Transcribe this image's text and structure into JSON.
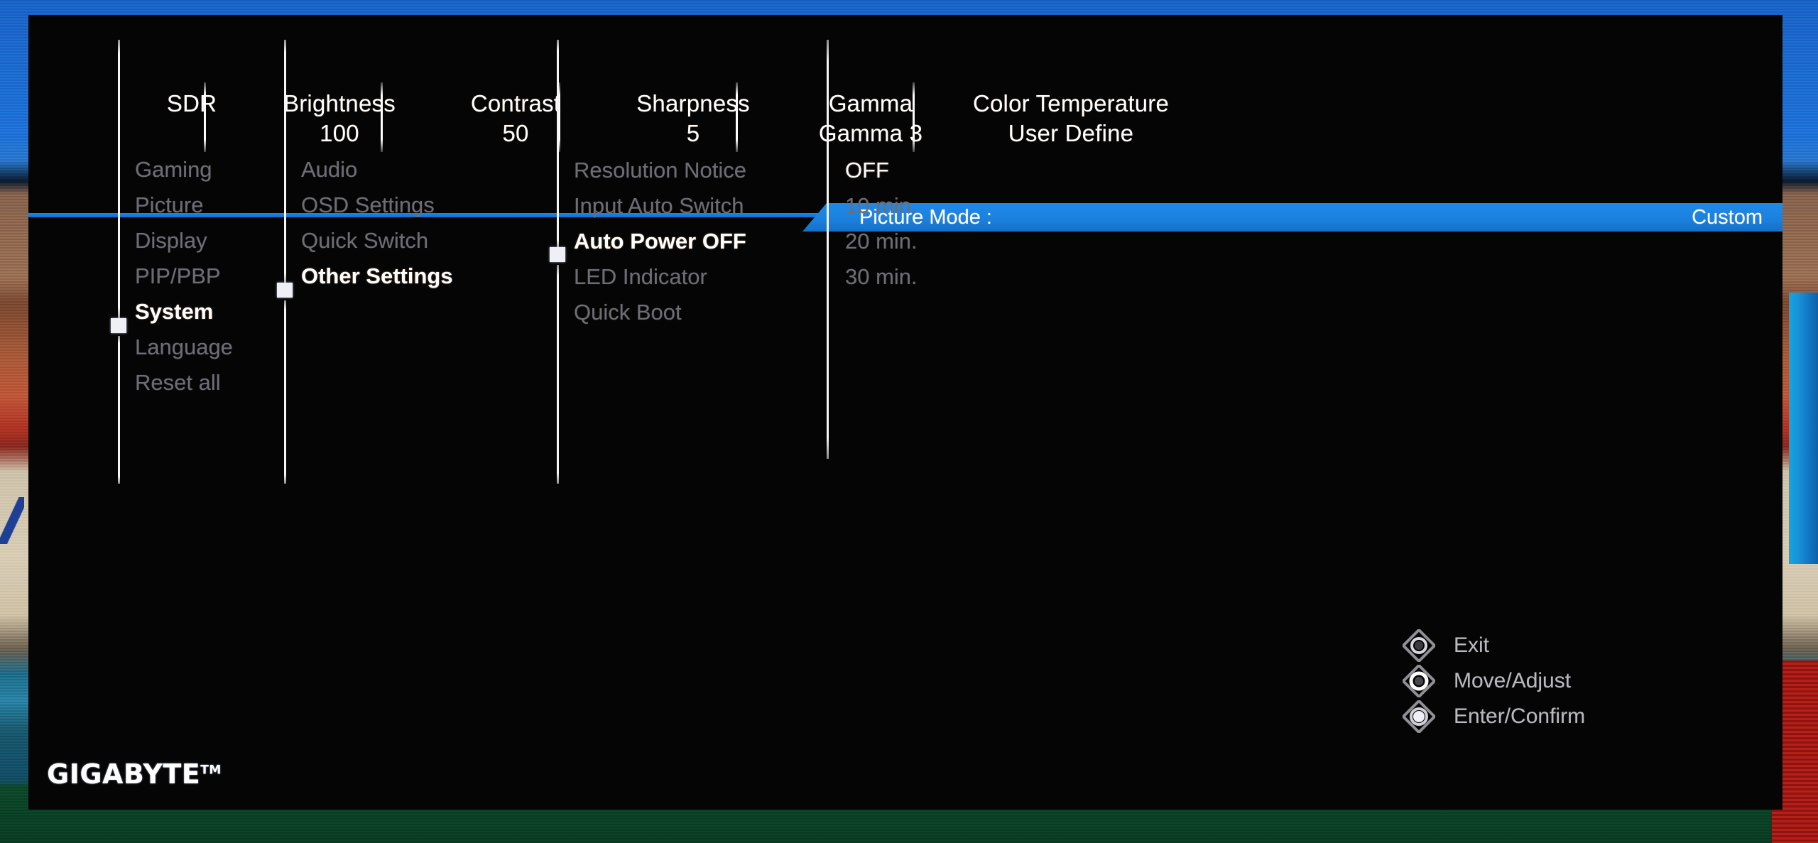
{
  "panel": {
    "brand": "GIGABYTE",
    "brand_tm": "TM"
  },
  "header": {
    "items": [
      {
        "label": "SDR",
        "value": ""
      },
      {
        "label": "Brightness",
        "value": "100"
      },
      {
        "label": "Contrast",
        "value": "50"
      },
      {
        "label": "Sharpness",
        "value": "5"
      },
      {
        "label": "Gamma",
        "value": "Gamma 3"
      },
      {
        "label": "Color Temperature",
        "value": "User Define"
      }
    ]
  },
  "picture_mode": {
    "label": "Picture Mode  :",
    "value": "Custom",
    "accent_color": "#1b81df"
  },
  "menu": {
    "column1": {
      "items": [
        {
          "label": "Gaming",
          "selected": false
        },
        {
          "label": "Picture",
          "selected": false
        },
        {
          "label": "Display",
          "selected": false
        },
        {
          "label": "PIP/PBP",
          "selected": false
        },
        {
          "label": "System",
          "selected": true
        },
        {
          "label": "Language",
          "selected": false
        },
        {
          "label": "Reset all",
          "selected": false
        }
      ]
    },
    "column2": {
      "items": [
        {
          "label": "Audio",
          "selected": false
        },
        {
          "label": "OSD Settings",
          "selected": false
        },
        {
          "label": "Quick Switch",
          "selected": false
        },
        {
          "label": "Other Settings",
          "selected": true
        }
      ]
    },
    "column3": {
      "items": [
        {
          "label": "Resolution Notice",
          "selected": false
        },
        {
          "label": "Input Auto Switch",
          "selected": false
        },
        {
          "label": "Auto Power OFF",
          "selected": true
        },
        {
          "label": "LED Indicator",
          "selected": false
        },
        {
          "label": "Quick Boot",
          "selected": false
        }
      ]
    },
    "column4": {
      "items": [
        {
          "label": "OFF",
          "selected": true
        },
        {
          "label": "10 min.",
          "selected": false
        },
        {
          "label": "20 min.",
          "selected": false
        },
        {
          "label": "30 min.",
          "selected": false
        }
      ]
    }
  },
  "controls": {
    "hints": [
      {
        "label": "Exit",
        "icon": "joystick-exit-icon"
      },
      {
        "label": "Move/Adjust",
        "icon": "joystick-move-icon"
      },
      {
        "label": "Enter/Confirm",
        "icon": "joystick-enter-icon"
      }
    ]
  }
}
